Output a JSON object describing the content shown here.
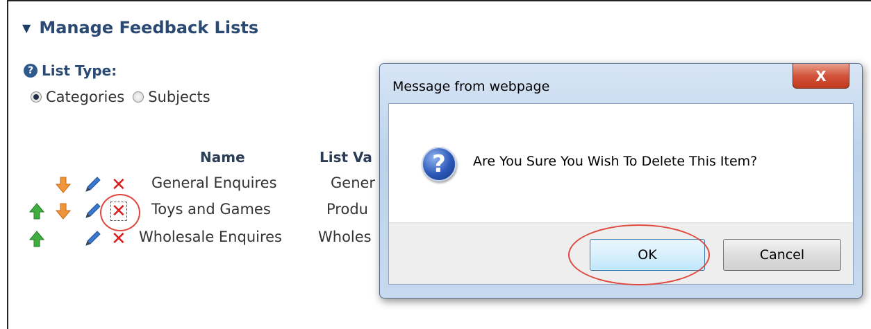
{
  "page": {
    "heading": "Manage Feedback Lists",
    "list_type_label": "List Type:",
    "help_glyph": "?",
    "radio_options": [
      {
        "label": "Categories",
        "checked": true
      },
      {
        "label": "Subjects",
        "checked": false
      }
    ]
  },
  "table": {
    "columns": [
      "Name",
      "List Va"
    ],
    "rows": [
      {
        "name": "General Enquires",
        "value": "Gener",
        "move_up": false,
        "move_down": true
      },
      {
        "name": "Toys and Games",
        "value": "Produ",
        "move_up": true,
        "move_down": true
      },
      {
        "name": "Wholesale Enquires",
        "value": "Wholes",
        "move_up": true,
        "move_down": false
      }
    ]
  },
  "dialog": {
    "title": "Message from webpage",
    "close_label": "X",
    "message": "Are You Sure You Wish To Delete This Item?",
    "icon": "question-icon",
    "icon_glyph": "?",
    "ok_label": "OK",
    "cancel_label": "Cancel"
  },
  "icons": {
    "collapse": "collapse-triangle-icon",
    "help": "help-icon",
    "up": "arrow-up-icon",
    "down": "arrow-down-icon",
    "edit": "pencil-icon",
    "delete": "delete-x-icon"
  },
  "colors": {
    "heading": "#2b4a73",
    "up_arrow": "#3fae3f",
    "down_arrow": "#f0953a",
    "delete": "#d62020",
    "annotation_ring": "#e0483f"
  },
  "glyphs": {
    "collapse": "▼",
    "delete": "✕"
  }
}
